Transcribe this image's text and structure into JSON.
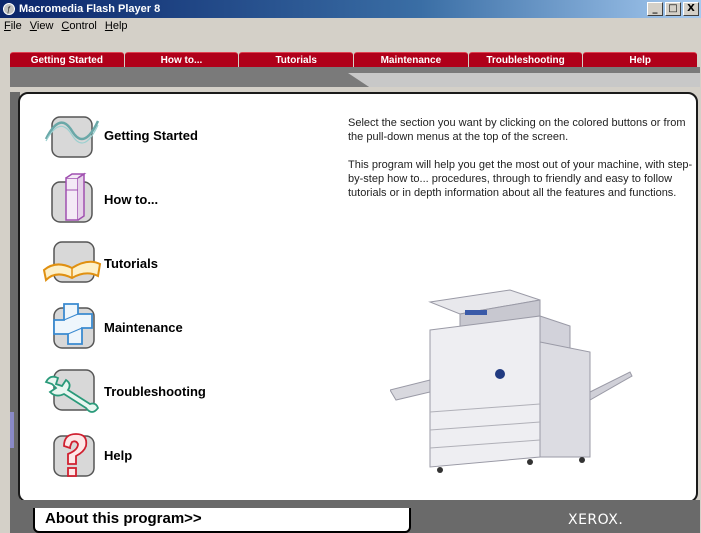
{
  "window": {
    "title": "Macromedia Flash Player 8",
    "controls": [
      "_",
      "□",
      "X"
    ]
  },
  "menubar": {
    "items": [
      "File",
      "View",
      "Control",
      "Help"
    ]
  },
  "tabs": [
    "Getting Started",
    "How to...",
    "Tutorials",
    "Maintenance",
    "Troubleshooting",
    "Help"
  ],
  "sections": [
    {
      "label": "Getting Started",
      "icon": "wave-chart-icon"
    },
    {
      "label": "How to...",
      "icon": "column-icon"
    },
    {
      "label": "Tutorials",
      "icon": "open-book-icon"
    },
    {
      "label": "Maintenance",
      "icon": "puzzle-cube-icon"
    },
    {
      "label": "Troubleshooting",
      "icon": "wrench-icon"
    },
    {
      "label": "Help",
      "icon": "question-mark-icon"
    }
  ],
  "description": {
    "p1": "Select the section you want by clicking on the colored buttons or from the pull-down menus at the top of the screen.",
    "p2": "This program will help you get the most out of your machine, with step-by-step how to... procedures, through to friendly and easy to follow tutorials or in depth information about all the features and functions."
  },
  "footer": {
    "about": "About this program>>",
    "brand": "XEROX."
  },
  "colors": {
    "tab_red": "#b0001a",
    "title_blue": "#0a246a"
  }
}
